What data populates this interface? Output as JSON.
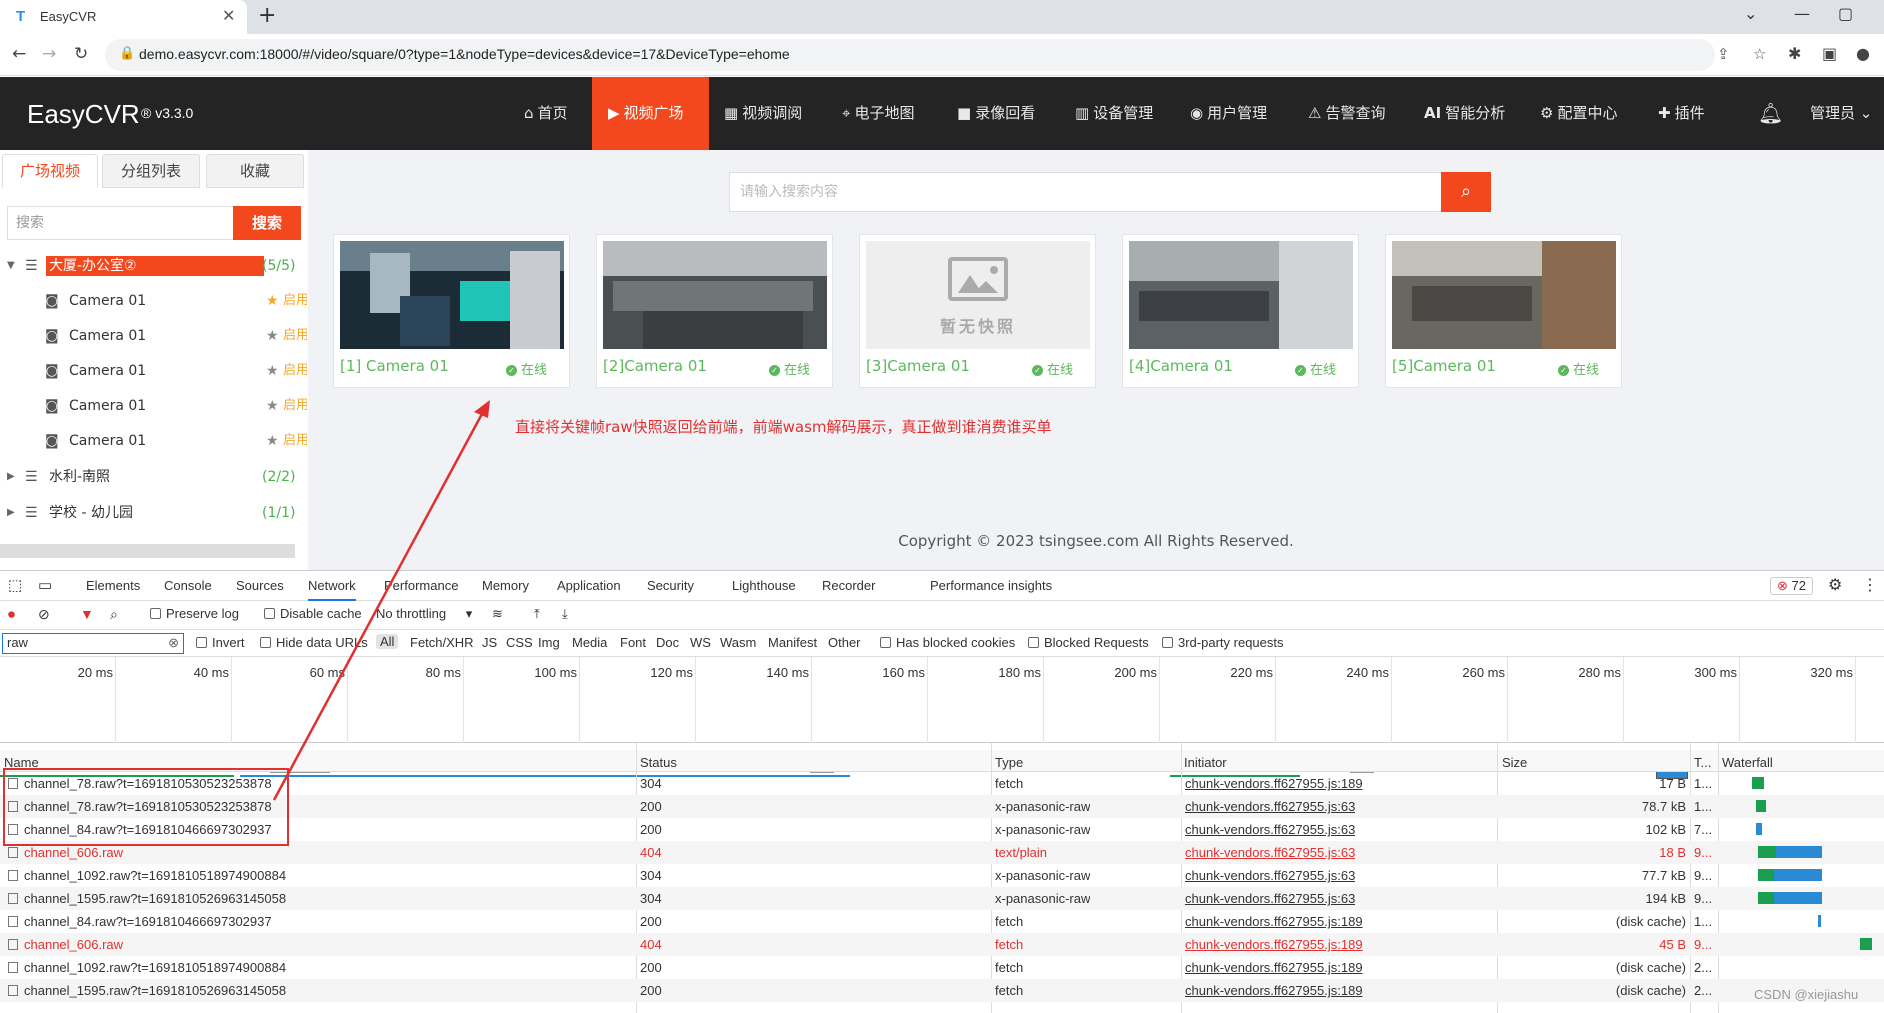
{
  "browser": {
    "tab_title": "EasyCVR",
    "url": "demo.easycvr.com:18000/#/video/square/0?type=1&nodeType=devices&device=17&DeviceType=ehome"
  },
  "app": {
    "logo": "EasyCVR",
    "version": "® v3.3.0",
    "nav": [
      {
        "label": "首页",
        "icon": "home-icon"
      },
      {
        "label": "视频广场",
        "icon": "play-icon",
        "active": true
      },
      {
        "label": "视频调阅",
        "icon": "grid-icon"
      },
      {
        "label": "电子地图",
        "icon": "map-pin-icon"
      },
      {
        "label": "录像回看",
        "icon": "video-camera-icon"
      },
      {
        "label": "设备管理",
        "icon": "device-icon"
      },
      {
        "label": "用户管理",
        "icon": "user-icon"
      },
      {
        "label": "告警查询",
        "icon": "alarm-icon"
      },
      {
        "label": "智能分析",
        "icon": "ai-icon",
        "prefix": "AI"
      },
      {
        "label": "配置中心",
        "icon": "gear-icon"
      },
      {
        "label": "插件",
        "icon": "puzzle-icon"
      }
    ],
    "user_menu": "管理员",
    "accent": "#f3471e"
  },
  "sidebar": {
    "tabs": [
      "广场视频",
      "分组列表",
      "收藏"
    ],
    "search_placeholder": "搜索",
    "search_button": "搜索",
    "tree": [
      {
        "label": "大厦-办公室②",
        "count": "(5/5)",
        "expanded": true,
        "selected": true
      },
      {
        "label": "Camera 01",
        "status": "启用",
        "starred": true
      },
      {
        "label": "Camera 01",
        "status": "启用"
      },
      {
        "label": "Camera 01",
        "status": "启用"
      },
      {
        "label": "Camera 01",
        "status": "启用"
      },
      {
        "label": "Camera 01",
        "status": "启用"
      },
      {
        "label": "水利-南照",
        "count": "(2/2)"
      },
      {
        "label": "学校 - 幼儿园",
        "count": "(1/1)"
      }
    ]
  },
  "main": {
    "search_placeholder": "请输入搜索内容",
    "cards": [
      {
        "name": "[1] Camera 01",
        "status": "在线"
      },
      {
        "name": "[2]Camera 01",
        "status": "在线"
      },
      {
        "name": "[3]Camera 01",
        "status": "在线",
        "no_snapshot": "暂无快照"
      },
      {
        "name": "[4]Camera 01",
        "status": "在线"
      },
      {
        "name": "[5]Camera 01",
        "status": "在线"
      }
    ],
    "annotation": "直接将关键帧raw快照返回给前端，前端wasm解码展示，真正做到谁消费谁买单",
    "copyright": "Copyright © 2023 tsingsee.com All Rights Reserved."
  },
  "devtools": {
    "tabs": [
      "Elements",
      "Console",
      "Sources",
      "Network",
      "Performance",
      "Memory",
      "Application",
      "Security",
      "Lighthouse",
      "Recorder",
      "Performance insights"
    ],
    "error_count": "72",
    "toolbar": {
      "preserve_log": "Preserve log",
      "disable_cache": "Disable cache",
      "throttling": "No throttling"
    },
    "filter": {
      "value": "raw",
      "invert": "Invert",
      "hide_data_urls": "Hide data URLs",
      "types": [
        "All",
        "Fetch/XHR",
        "JS",
        "CSS",
        "Img",
        "Media",
        "Font",
        "Doc",
        "WS",
        "Wasm",
        "Manifest",
        "Other"
      ],
      "has_blocked_cookies": "Has blocked cookies",
      "blocked_requests": "Blocked Requests",
      "third_party": "3rd-party requests"
    },
    "timeline_marks": [
      "20 ms",
      "40 ms",
      "60 ms",
      "80 ms",
      "100 ms",
      "120 ms",
      "140 ms",
      "160 ms",
      "180 ms",
      "200 ms",
      "220 ms",
      "240 ms",
      "260 ms",
      "280 ms",
      "300 ms",
      "320 ms"
    ],
    "columns": [
      "Name",
      "Status",
      "Type",
      "Initiator",
      "Size",
      "T...",
      "Waterfall"
    ],
    "rows": [
      {
        "name": "channel_78.raw?t=1691810530523253878",
        "status": "304",
        "type": "fetch",
        "initiator": "chunk-vendors.ff627955.js:189",
        "size": "17 B",
        "time": "1..."
      },
      {
        "name": "channel_78.raw?t=1691810530523253878",
        "status": "200",
        "type": "x-panasonic-raw",
        "initiator": "chunk-vendors.ff627955.js:63",
        "size": "78.7 kB",
        "time": "1..."
      },
      {
        "name": "channel_84.raw?t=1691810466697302937",
        "status": "200",
        "type": "x-panasonic-raw",
        "initiator": "chunk-vendors.ff627955.js:63",
        "size": "102 kB",
        "time": "7..."
      },
      {
        "name": "channel_606.raw",
        "status": "404",
        "type": "text/plain",
        "initiator": "chunk-vendors.ff627955.js:63",
        "size": "18 B",
        "time": "9...",
        "error": true
      },
      {
        "name": "channel_1092.raw?t=1691810518974900884",
        "status": "304",
        "type": "x-panasonic-raw",
        "initiator": "chunk-vendors.ff627955.js:63",
        "size": "77.7 kB",
        "time": "9..."
      },
      {
        "name": "channel_1595.raw?t=1691810526963145058",
        "status": "304",
        "type": "x-panasonic-raw",
        "initiator": "chunk-vendors.ff627955.js:63",
        "size": "194 kB",
        "time": "9..."
      },
      {
        "name": "channel_84.raw?t=1691810466697302937",
        "status": "200",
        "type": "fetch",
        "initiator": "chunk-vendors.ff627955.js:189",
        "size": "(disk cache)",
        "time": "1..."
      },
      {
        "name": "channel_606.raw",
        "status": "404",
        "type": "fetch",
        "initiator": "chunk-vendors.ff627955.js:189",
        "size": "45 B",
        "time": "9...",
        "error": true
      },
      {
        "name": "channel_1092.raw?t=1691810518974900884",
        "status": "200",
        "type": "fetch",
        "initiator": "chunk-vendors.ff627955.js:189",
        "size": "(disk cache)",
        "time": "2..."
      },
      {
        "name": "channel_1595.raw?t=1691810526963145058",
        "status": "200",
        "type": "fetch",
        "initiator": "chunk-vendors.ff627955.js:189",
        "size": "(disk cache)",
        "time": "2..."
      }
    ]
  },
  "watermark": "CSDN @xiejiashu"
}
